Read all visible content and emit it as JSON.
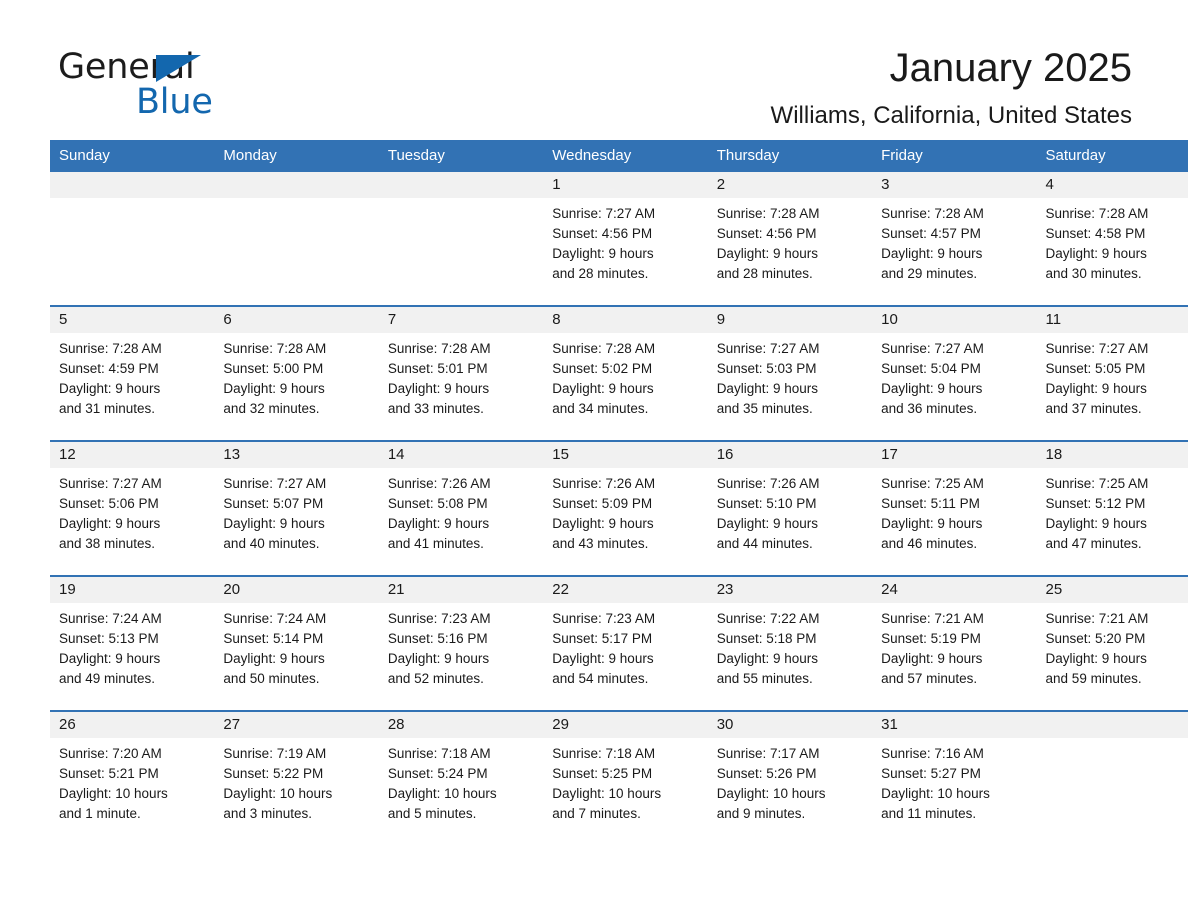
{
  "brand": {
    "name_part1": "General",
    "name_part2": "Blue",
    "triangle_color": "#1367ae"
  },
  "header": {
    "title": "January 2025",
    "subtitle": "Williams, California, United States"
  },
  "theme": {
    "header_blue": "#3272b4",
    "divider_blue": "#3272b4",
    "daynum_band": "#f1f1f1",
    "text": "#1a1a1a"
  },
  "weekdays": [
    "Sunday",
    "Monday",
    "Tuesday",
    "Wednesday",
    "Thursday",
    "Friday",
    "Saturday"
  ],
  "weeks": [
    [
      {
        "day": "",
        "sunrise": "",
        "sunset": "",
        "daylight1": "",
        "daylight2": ""
      },
      {
        "day": "",
        "sunrise": "",
        "sunset": "",
        "daylight1": "",
        "daylight2": ""
      },
      {
        "day": "",
        "sunrise": "",
        "sunset": "",
        "daylight1": "",
        "daylight2": ""
      },
      {
        "day": "1",
        "sunrise": "Sunrise: 7:27 AM",
        "sunset": "Sunset: 4:56 PM",
        "daylight1": "Daylight: 9 hours",
        "daylight2": "and 28 minutes."
      },
      {
        "day": "2",
        "sunrise": "Sunrise: 7:28 AM",
        "sunset": "Sunset: 4:56 PM",
        "daylight1": "Daylight: 9 hours",
        "daylight2": "and 28 minutes."
      },
      {
        "day": "3",
        "sunrise": "Sunrise: 7:28 AM",
        "sunset": "Sunset: 4:57 PM",
        "daylight1": "Daylight: 9 hours",
        "daylight2": "and 29 minutes."
      },
      {
        "day": "4",
        "sunrise": "Sunrise: 7:28 AM",
        "sunset": "Sunset: 4:58 PM",
        "daylight1": "Daylight: 9 hours",
        "daylight2": "and 30 minutes."
      }
    ],
    [
      {
        "day": "5",
        "sunrise": "Sunrise: 7:28 AM",
        "sunset": "Sunset: 4:59 PM",
        "daylight1": "Daylight: 9 hours",
        "daylight2": "and 31 minutes."
      },
      {
        "day": "6",
        "sunrise": "Sunrise: 7:28 AM",
        "sunset": "Sunset: 5:00 PM",
        "daylight1": "Daylight: 9 hours",
        "daylight2": "and 32 minutes."
      },
      {
        "day": "7",
        "sunrise": "Sunrise: 7:28 AM",
        "sunset": "Sunset: 5:01 PM",
        "daylight1": "Daylight: 9 hours",
        "daylight2": "and 33 minutes."
      },
      {
        "day": "8",
        "sunrise": "Sunrise: 7:28 AM",
        "sunset": "Sunset: 5:02 PM",
        "daylight1": "Daylight: 9 hours",
        "daylight2": "and 34 minutes."
      },
      {
        "day": "9",
        "sunrise": "Sunrise: 7:27 AM",
        "sunset": "Sunset: 5:03 PM",
        "daylight1": "Daylight: 9 hours",
        "daylight2": "and 35 minutes."
      },
      {
        "day": "10",
        "sunrise": "Sunrise: 7:27 AM",
        "sunset": "Sunset: 5:04 PM",
        "daylight1": "Daylight: 9 hours",
        "daylight2": "and 36 minutes."
      },
      {
        "day": "11",
        "sunrise": "Sunrise: 7:27 AM",
        "sunset": "Sunset: 5:05 PM",
        "daylight1": "Daylight: 9 hours",
        "daylight2": "and 37 minutes."
      }
    ],
    [
      {
        "day": "12",
        "sunrise": "Sunrise: 7:27 AM",
        "sunset": "Sunset: 5:06 PM",
        "daylight1": "Daylight: 9 hours",
        "daylight2": "and 38 minutes."
      },
      {
        "day": "13",
        "sunrise": "Sunrise: 7:27 AM",
        "sunset": "Sunset: 5:07 PM",
        "daylight1": "Daylight: 9 hours",
        "daylight2": "and 40 minutes."
      },
      {
        "day": "14",
        "sunrise": "Sunrise: 7:26 AM",
        "sunset": "Sunset: 5:08 PM",
        "daylight1": "Daylight: 9 hours",
        "daylight2": "and 41 minutes."
      },
      {
        "day": "15",
        "sunrise": "Sunrise: 7:26 AM",
        "sunset": "Sunset: 5:09 PM",
        "daylight1": "Daylight: 9 hours",
        "daylight2": "and 43 minutes."
      },
      {
        "day": "16",
        "sunrise": "Sunrise: 7:26 AM",
        "sunset": "Sunset: 5:10 PM",
        "daylight1": "Daylight: 9 hours",
        "daylight2": "and 44 minutes."
      },
      {
        "day": "17",
        "sunrise": "Sunrise: 7:25 AM",
        "sunset": "Sunset: 5:11 PM",
        "daylight1": "Daylight: 9 hours",
        "daylight2": "and 46 minutes."
      },
      {
        "day": "18",
        "sunrise": "Sunrise: 7:25 AM",
        "sunset": "Sunset: 5:12 PM",
        "daylight1": "Daylight: 9 hours",
        "daylight2": "and 47 minutes."
      }
    ],
    [
      {
        "day": "19",
        "sunrise": "Sunrise: 7:24 AM",
        "sunset": "Sunset: 5:13 PM",
        "daylight1": "Daylight: 9 hours",
        "daylight2": "and 49 minutes."
      },
      {
        "day": "20",
        "sunrise": "Sunrise: 7:24 AM",
        "sunset": "Sunset: 5:14 PM",
        "daylight1": "Daylight: 9 hours",
        "daylight2": "and 50 minutes."
      },
      {
        "day": "21",
        "sunrise": "Sunrise: 7:23 AM",
        "sunset": "Sunset: 5:16 PM",
        "daylight1": "Daylight: 9 hours",
        "daylight2": "and 52 minutes."
      },
      {
        "day": "22",
        "sunrise": "Sunrise: 7:23 AM",
        "sunset": "Sunset: 5:17 PM",
        "daylight1": "Daylight: 9 hours",
        "daylight2": "and 54 minutes."
      },
      {
        "day": "23",
        "sunrise": "Sunrise: 7:22 AM",
        "sunset": "Sunset: 5:18 PM",
        "daylight1": "Daylight: 9 hours",
        "daylight2": "and 55 minutes."
      },
      {
        "day": "24",
        "sunrise": "Sunrise: 7:21 AM",
        "sunset": "Sunset: 5:19 PM",
        "daylight1": "Daylight: 9 hours",
        "daylight2": "and 57 minutes."
      },
      {
        "day": "25",
        "sunrise": "Sunrise: 7:21 AM",
        "sunset": "Sunset: 5:20 PM",
        "daylight1": "Daylight: 9 hours",
        "daylight2": "and 59 minutes."
      }
    ],
    [
      {
        "day": "26",
        "sunrise": "Sunrise: 7:20 AM",
        "sunset": "Sunset: 5:21 PM",
        "daylight1": "Daylight: 10 hours",
        "daylight2": "and 1 minute."
      },
      {
        "day": "27",
        "sunrise": "Sunrise: 7:19 AM",
        "sunset": "Sunset: 5:22 PM",
        "daylight1": "Daylight: 10 hours",
        "daylight2": "and 3 minutes."
      },
      {
        "day": "28",
        "sunrise": "Sunrise: 7:18 AM",
        "sunset": "Sunset: 5:24 PM",
        "daylight1": "Daylight: 10 hours",
        "daylight2": "and 5 minutes."
      },
      {
        "day": "29",
        "sunrise": "Sunrise: 7:18 AM",
        "sunset": "Sunset: 5:25 PM",
        "daylight1": "Daylight: 10 hours",
        "daylight2": "and 7 minutes."
      },
      {
        "day": "30",
        "sunrise": "Sunrise: 7:17 AM",
        "sunset": "Sunset: 5:26 PM",
        "daylight1": "Daylight: 10 hours",
        "daylight2": "and 9 minutes."
      },
      {
        "day": "31",
        "sunrise": "Sunrise: 7:16 AM",
        "sunset": "Sunset: 5:27 PM",
        "daylight1": "Daylight: 10 hours",
        "daylight2": "and 11 minutes."
      },
      {
        "day": "",
        "sunrise": "",
        "sunset": "",
        "daylight1": "",
        "daylight2": ""
      }
    ]
  ]
}
